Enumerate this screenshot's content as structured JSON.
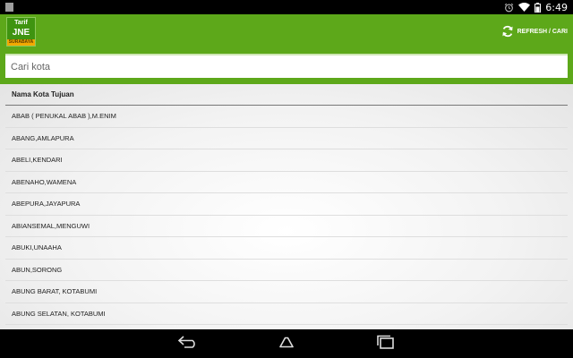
{
  "status_bar": {
    "time": "6:49"
  },
  "app_bar": {
    "logo": {
      "line1": "Tarif",
      "line2": "JNE",
      "line3": "SURABAYA"
    },
    "refresh_label": "REFRESH / CARI"
  },
  "search": {
    "placeholder": "Cari kota",
    "value": ""
  },
  "list": {
    "header": "Nama Kota Tujuan",
    "items": [
      "ABAB ( PENUKAL ABAB ),M.ENIM",
      "ABANG,AMLAPURA",
      "ABELI,KENDARI",
      "ABENAHO,WAMENA",
      "ABEPURA,JAYAPURA",
      "ABIANSEMAL,MENGUWI",
      "ABUKI,UNAAHA",
      "ABUN,SORONG",
      "ABUNG BARAT, KOTABUMI",
      "ABUNG SELATAN, KOTABUMI"
    ]
  },
  "colors": {
    "app_bar": "#5da81a",
    "logo_badge": "#f2a900"
  },
  "icons": {
    "refresh": "refresh-icon",
    "back": "back-nav-icon",
    "home": "home-nav-icon",
    "recents": "recents-nav-icon"
  }
}
